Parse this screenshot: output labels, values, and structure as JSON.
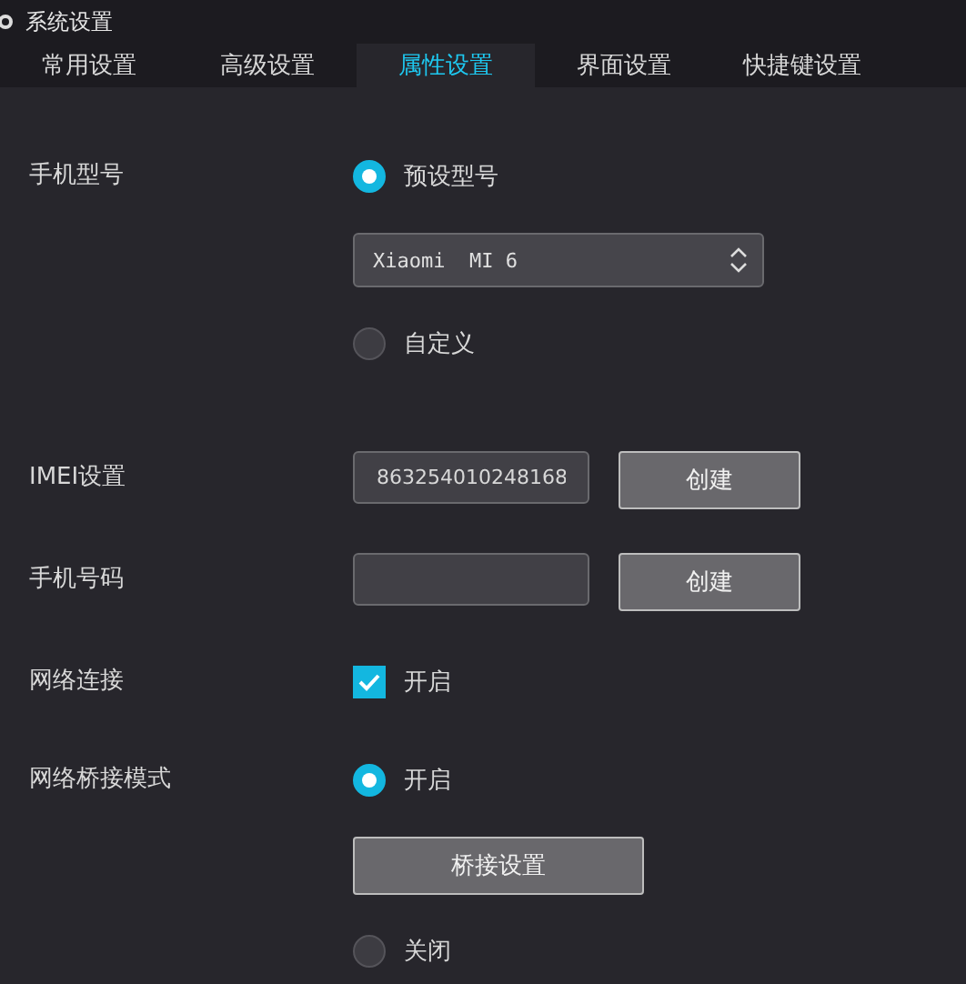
{
  "window": {
    "title": "系统设置"
  },
  "tabs": [
    {
      "label": "常用设置",
      "selected": false
    },
    {
      "label": "高级设置",
      "selected": false
    },
    {
      "label": "属性设置",
      "selected": true
    },
    {
      "label": "界面设置",
      "selected": false
    },
    {
      "label": "快捷键设置",
      "selected": false
    }
  ],
  "rows": [
    {
      "kind": "stack",
      "label": "手机型号",
      "controls": [
        {
          "kind": "radio",
          "label": "预设型号",
          "selected": true
        },
        {
          "kind": "select",
          "value": "Xiaomi  MI 6"
        },
        {
          "kind": "radio",
          "label": "自定义",
          "selected": false
        }
      ]
    },
    {
      "kind": "inline",
      "label": "IMEI设置",
      "controls": [
        {
          "kind": "input",
          "value": "863254010248168"
        },
        {
          "kind": "button",
          "label": "创建"
        }
      ]
    },
    {
      "kind": "inline",
      "label": "手机号码",
      "controls": [
        {
          "kind": "input"
        },
        {
          "kind": "button",
          "label": "创建"
        }
      ]
    },
    {
      "kind": "inline",
      "label": "网络连接",
      "controls": [
        {
          "kind": "checkbox",
          "label": "开启",
          "checked": true
        }
      ]
    },
    {
      "kind": "stack",
      "label": "网络桥接模式",
      "controls": [
        {
          "kind": "radio",
          "label": "开启",
          "selected": true
        },
        {
          "kind": "wide-button",
          "label": "桥接设置"
        },
        {
          "kind": "radio",
          "label": "关闭",
          "selected": false
        }
      ]
    }
  ]
}
